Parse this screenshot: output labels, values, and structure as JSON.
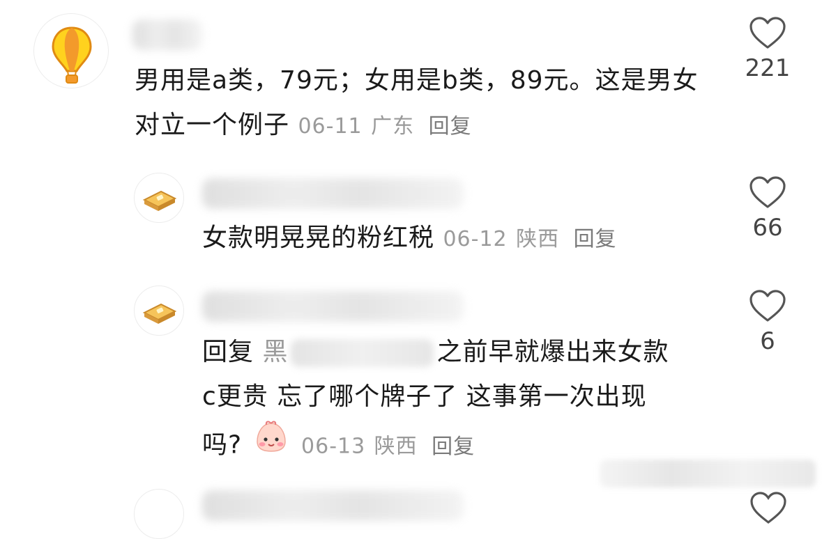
{
  "comments": [
    {
      "text": "男用是a类，79元；女用是b类，89元。这是男女对立一个例子",
      "date": "06-11",
      "location": "广东",
      "reply_label": "回复",
      "likes": "221"
    }
  ],
  "replies": [
    {
      "text": "女款明晃晃的粉红税",
      "date": "06-12",
      "location": "陕西",
      "reply_label": "回复",
      "likes": "66"
    },
    {
      "prefix": "回复",
      "target_visible": "黑",
      "text_line1": "之前早就爆出来女款",
      "text_line2": "c更贵 忘了哪个牌子了 这事第一次出现",
      "text_line3": "吗?",
      "emoji": "blush-face-emoji",
      "date": "06-13",
      "location": "陕西",
      "reply_label": "回复",
      "likes": "6"
    }
  ],
  "icons": {
    "heart": "heart-outline-icon",
    "avatar_main": "hot-air-balloon-avatar",
    "avatar_reply": "toast-avatar"
  },
  "colors": {
    "text": "#1a1a1a",
    "meta": "#9a9a9a",
    "balloon_orange": "#f39a2b",
    "balloon_yellow": "#ffd21e"
  }
}
